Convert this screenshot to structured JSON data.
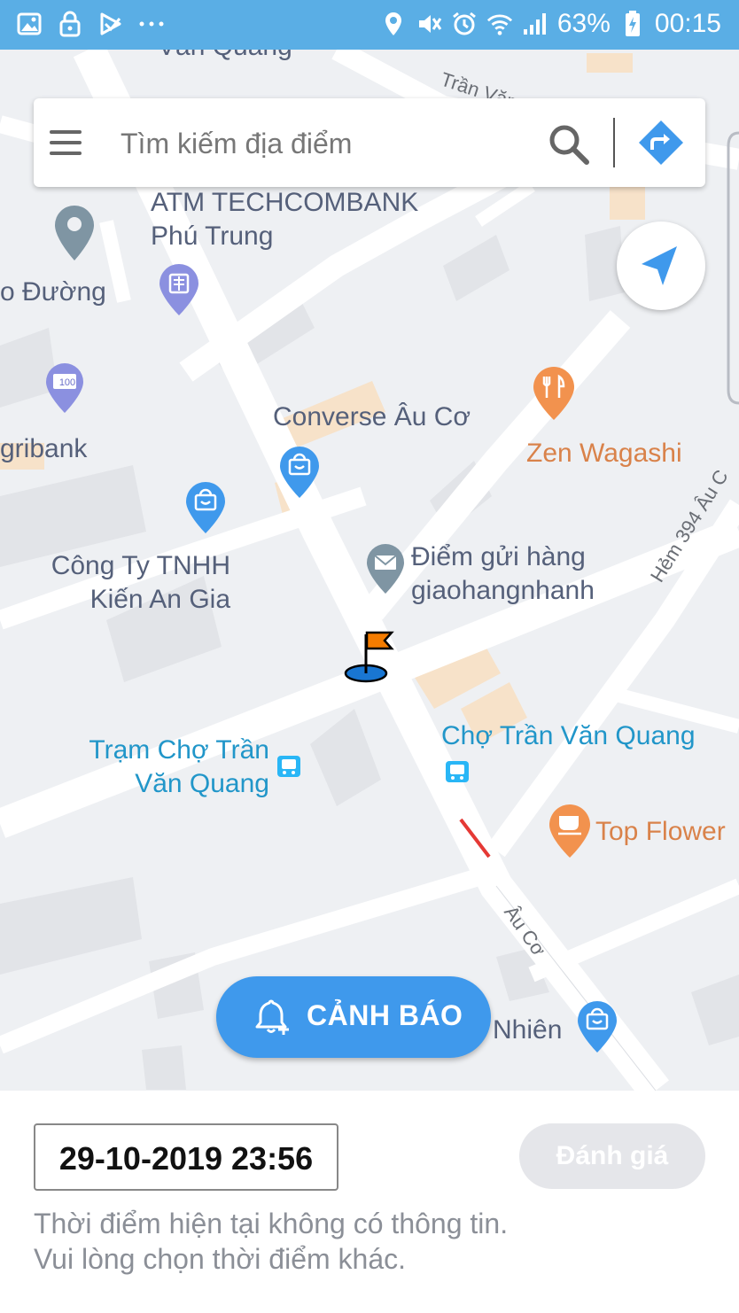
{
  "status_bar": {
    "battery": "63%",
    "time": "00:15"
  },
  "search": {
    "placeholder": "Tìm kiếm địa điểm"
  },
  "map": {
    "labels": {
      "top_road": "Văn Quang",
      "top_right_road": "Trần Văn Quan",
      "atm": "ATM TECHCOMBANK\nPhú Trung",
      "left_edge_road": "o Đường",
      "agribank": "gribank",
      "converse": "Converse Âu Cơ",
      "zen": "Zen Wagashi",
      "hem": "Hẻm 394 Âu C",
      "cong_ty": "Công Ty TNHH\nKiến An Gia",
      "diem_gui": "Điểm gửi hàng\ngiaohangnhanh",
      "tram_cho": "Trạm Chợ Trần\nVăn Quang",
      "cho_tran": "Chợ Trần Văn Quang",
      "top_flower": "Top Flower",
      "au_co": "Âu Cơ",
      "nhien": "Nhiên"
    },
    "atm_code": "100"
  },
  "alert_button": {
    "label": "CẢNH BÁO"
  },
  "bottom": {
    "datetime": "29-10-2019 23:56",
    "rate_label": "Đánh giá",
    "message_line1": "Thời điểm hiện tại không có thông tin.",
    "message_line2": "Vui lòng chọn thời điểm khác."
  },
  "colors": {
    "status_bar": "#5aaee5",
    "primary": "#3f99ec",
    "map_bg": "#eef0f3",
    "road": "#ffffff"
  }
}
